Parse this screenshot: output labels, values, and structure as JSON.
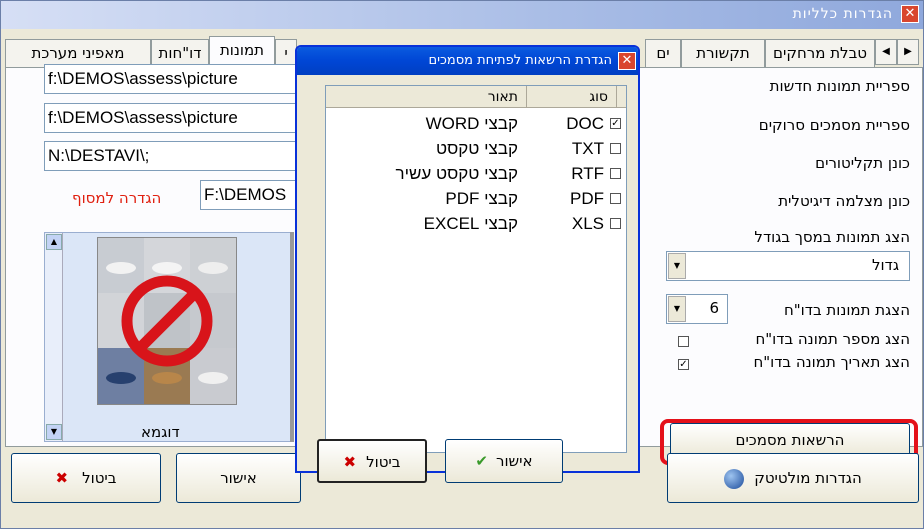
{
  "window": {
    "title": "הגדרות כלליות"
  },
  "tabs": [
    "מאפיני מערכת",
    "דו\"חות",
    "תמונות",
    "י",
    "ים",
    "תקשורת",
    "טבלת מרחקים"
  ],
  "fields": {
    "pictures_folder": "f:\\DEMOS\\assess\\picture",
    "scanned_docs_folder": "f:\\DEMOS\\assess\\picture",
    "cd_drive": "N:\\DESTAVI\\;",
    "camera_drive": "F:\\DEMOS"
  },
  "labels": {
    "new_pictures_lib": "ספריית תמונות חדשות",
    "scanned_docs_lib": "ספריית מסמכים סרוקים",
    "cd_drive": "כונן תקליטורים",
    "camera_drive": "כונן מצלמה דיגיטלית",
    "show_pictures_size": "הצג תמונות במסך בגודל",
    "pictures_in_report": "הצגת תמונות בדו\"ח",
    "show_pic_number": "הצג מספר תמונה בדו\"ח",
    "show_pic_date": "הצג תאריך תמונה בדו\"ח",
    "set_terminal": "הגדרה למסוף",
    "sample": "דוגמא"
  },
  "combos": {
    "size": "גדול",
    "count": "6"
  },
  "checks": {
    "show_pic_number": false,
    "show_pic_date": true
  },
  "buttons": {
    "doc_permissions": "הרשאות מסמכים",
    "multitech_settings": "הגדרות מולטיטק",
    "ok": "אישור",
    "cancel": "ביטול"
  },
  "dialog": {
    "title": "הגדרת הרשאות לפתיחת מסמכים",
    "col_type": "סוג",
    "col_desc": "תאור",
    "rows": [
      {
        "type": "DOC",
        "desc": "קבצי WORD",
        "checked": true
      },
      {
        "type": "TXT",
        "desc": "קבצי טקסט",
        "checked": false
      },
      {
        "type": "RTF",
        "desc": "קבצי טקסט עשיר",
        "checked": false
      },
      {
        "type": "PDF",
        "desc": "קבצי PDF",
        "checked": false
      },
      {
        "type": "XLS",
        "desc": "קבצי EXCEL",
        "checked": false
      }
    ],
    "ok": "אישור",
    "cancel": "ביטול"
  },
  "colors": {
    "highlight": "#e4101a",
    "title_blue": "#0046d5",
    "terminal_label": "#e02010"
  }
}
